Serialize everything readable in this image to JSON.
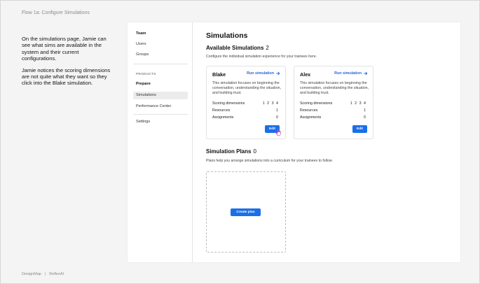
{
  "flow_title": "Flow 1a: Configure Simulations",
  "notes": [
    "On the simulations page, Jamie can see what sims are available in the system and their current configurations.",
    "Jamie notices the scoring dimensions are not quite what they want so they click into the Blake simulation."
  ],
  "footer": {
    "left": "DesignMap",
    "separator": "|",
    "right": "ReflexAI"
  },
  "sidebar": {
    "team": "Team",
    "users": "Users",
    "groups": "Groups",
    "products_section": "PRODUCTS",
    "prepare": "Prepare",
    "simulations": "Simulations",
    "performance_center": "Performance Center",
    "settings": "Settings"
  },
  "main": {
    "page_title": "Simulations",
    "available": {
      "title": "Available Simulations",
      "count": "2",
      "description": "Configure the individual simulation experience for your trainees here."
    },
    "simulations": [
      {
        "name": "Blake",
        "run_label": "Run simulation",
        "description": "This simulation focuses on beginning the conversation, understanding the situation, and building trust.",
        "scoring_label": "Scoring dimensions",
        "scoring_values": [
          "1",
          "2",
          "3",
          "4"
        ],
        "resources_label": "Resources",
        "resources_value": "1",
        "assignments_label": "Assignments",
        "assignments_value": "0",
        "edit_label": "Edit"
      },
      {
        "name": "Alex",
        "run_label": "Run simulation",
        "description": "This simulation focuses on beginning the conversation, understanding the situation, and building trust.",
        "scoring_label": "Scoring dimensions",
        "scoring_values": [
          "1",
          "2",
          "3",
          "4"
        ],
        "resources_label": "Resources",
        "resources_value": "1",
        "assignments_label": "Assignments",
        "assignments_value": "0",
        "edit_label": "Edit"
      }
    ],
    "plans": {
      "title": "Simulation Plans",
      "count": "0",
      "description": "Plans help you arrange simulations into a curriculum for your trainees to follow.",
      "create_label": "Create plan"
    }
  },
  "colors": {
    "accent": "#1a6fe8",
    "link": "#2a64e0",
    "cursor": "#c03ab8"
  },
  "icons": {
    "run_arrow": "arrow-right-icon",
    "cursor": "hand-pointer-icon"
  }
}
